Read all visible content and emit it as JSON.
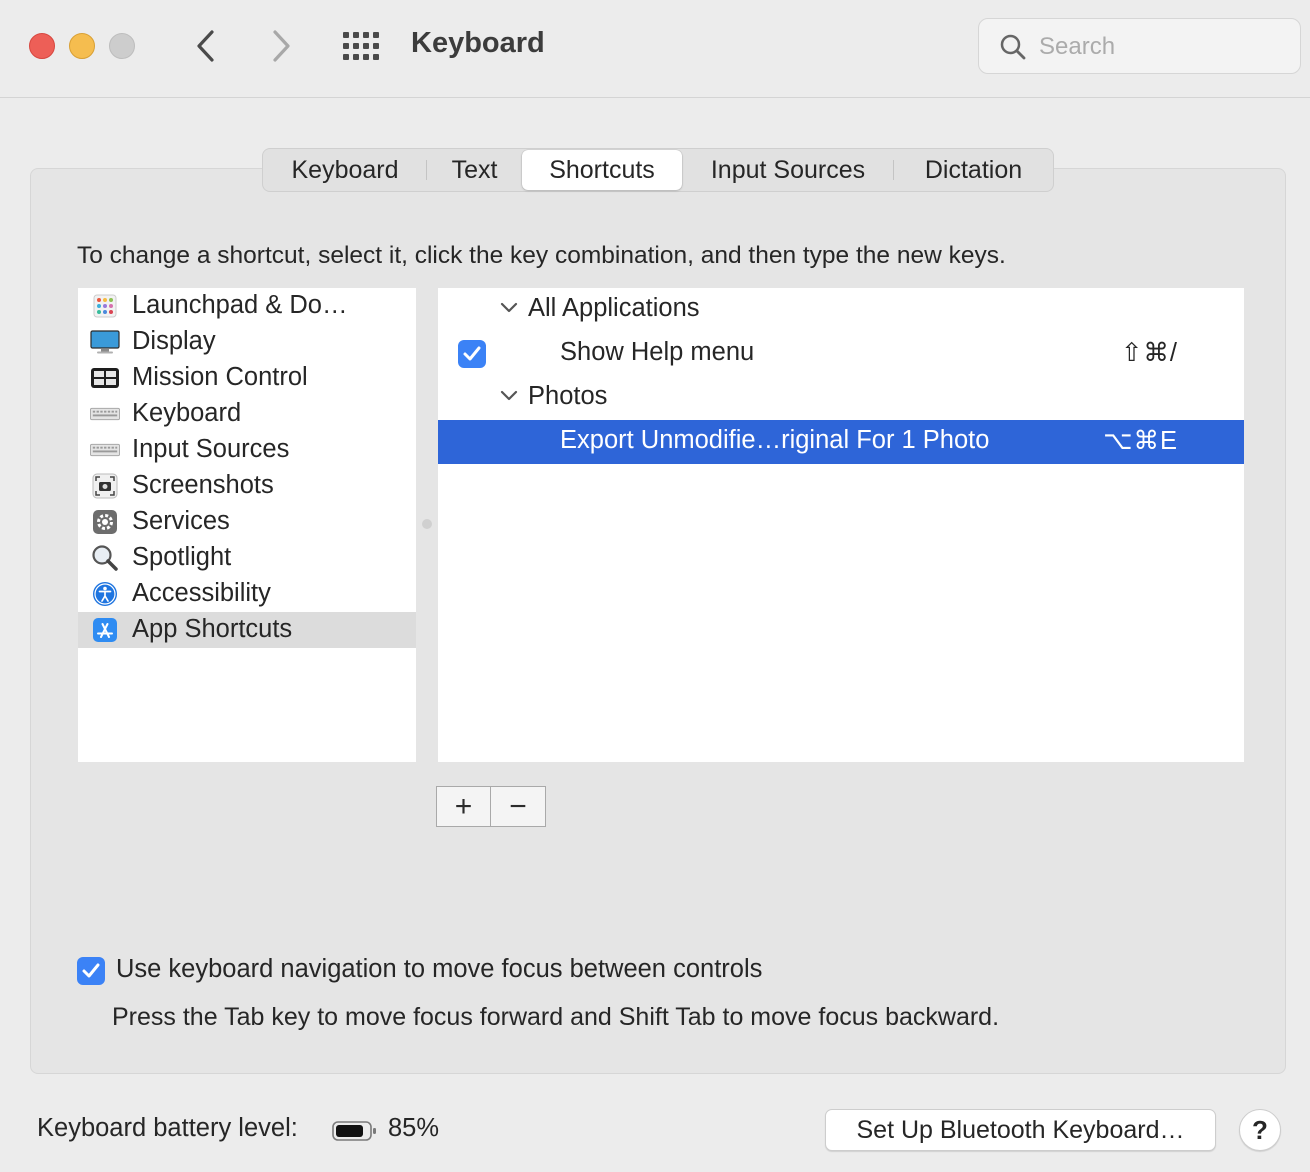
{
  "window": {
    "title": "Keyboard",
    "search_placeholder": "Search"
  },
  "tabs": [
    {
      "label": "Keyboard"
    },
    {
      "label": "Text"
    },
    {
      "label": "Shortcuts",
      "active": true
    },
    {
      "label": "Input Sources"
    },
    {
      "label": "Dictation"
    }
  ],
  "instructions": "To change a shortcut, select it, click the key combination, and then type the new keys.",
  "categories": [
    {
      "label": "Launchpad & Do…",
      "icon": "launchpad-icon"
    },
    {
      "label": "Display",
      "icon": "display-icon"
    },
    {
      "label": "Mission Control",
      "icon": "mission-control-icon"
    },
    {
      "label": "Keyboard",
      "icon": "keyboard-icon"
    },
    {
      "label": "Input Sources",
      "icon": "keyboard-icon"
    },
    {
      "label": "Screenshots",
      "icon": "screenshot-icon"
    },
    {
      "label": "Services",
      "icon": "gear-icon"
    },
    {
      "label": "Spotlight",
      "icon": "magnifier-icon"
    },
    {
      "label": "Accessibility",
      "icon": "accessibility-icon"
    },
    {
      "label": "App Shortcuts",
      "icon": "app-store-icon",
      "selected": true
    }
  ],
  "shortcuts": {
    "groups": [
      {
        "name": "All Applications",
        "items": [
          {
            "label": "Show Help menu",
            "keys": "⇧⌘/",
            "checked": true
          }
        ]
      },
      {
        "name": "Photos",
        "items": [
          {
            "label": "Export Unmodifie…riginal For 1 Photo",
            "keys": "⌥⌘E",
            "selected": true
          }
        ]
      }
    ]
  },
  "buttons": {
    "add": "+",
    "remove": "−",
    "bluetooth": "Set Up Bluetooth Keyboard…",
    "help": "?"
  },
  "keyboard_navigation": {
    "label": "Use keyboard navigation to move focus between controls",
    "checked": true,
    "help": "Press the Tab key to move focus forward and Shift Tab to move focus backward."
  },
  "battery": {
    "label": "Keyboard battery level:",
    "percent_text": "85%",
    "level": 0.85
  },
  "colors": {
    "selection": "#2e65d8",
    "checkbox": "#3b82f6",
    "close": "#ed5f57",
    "minimize": "#f5bd4f"
  }
}
